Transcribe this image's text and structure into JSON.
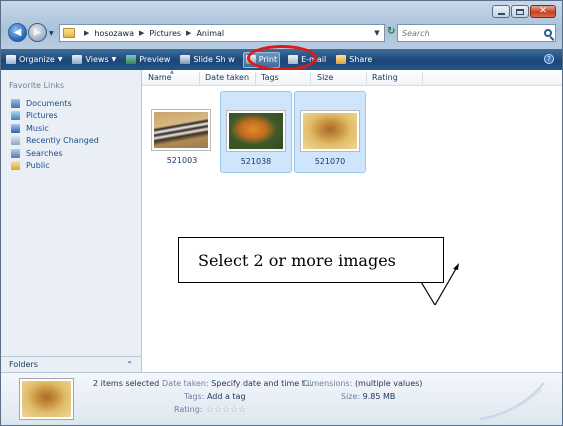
{
  "address": {
    "crumbs": [
      "hosozawa",
      "Pictures",
      "Animal"
    ]
  },
  "search": {
    "placeholder": "Search"
  },
  "toolbar": {
    "organize": "Organize",
    "views": "Views",
    "preview": "Preview",
    "slideshow": "Slide Sh w",
    "print": "Print",
    "email": "E-mail",
    "share": "Share"
  },
  "sidebar": {
    "title": "Favorite Links",
    "links": [
      "Documents",
      "Pictures",
      "Music",
      "Recently Changed",
      "Searches",
      "Public"
    ],
    "folders": "Folders"
  },
  "columns": [
    "Name",
    "Date taken",
    "Tags",
    "Size",
    "Rating"
  ],
  "files": [
    {
      "name": "521003",
      "selected": false
    },
    {
      "name": "521038",
      "selected": true
    },
    {
      "name": "521070",
      "selected": true
    }
  ],
  "annotation": "Select 2 or more images",
  "details": {
    "selection": "2 items selected",
    "date_taken_label": "Date taken:",
    "date_taken_value": "Specify date and time t...",
    "tags_label": "Tags:",
    "tags_value": "Add a tag",
    "rating_label": "Rating:",
    "rating_stars": "☆☆☆☆☆",
    "dimensions_label": "Dimensions:",
    "dimensions_value": "(multiple values)",
    "size_label": "Size:",
    "size_value": "9.85 MB"
  },
  "colors": {
    "toolbar": "#1b4677",
    "highlight": "#e01818",
    "selection": "#cfe5fb"
  }
}
